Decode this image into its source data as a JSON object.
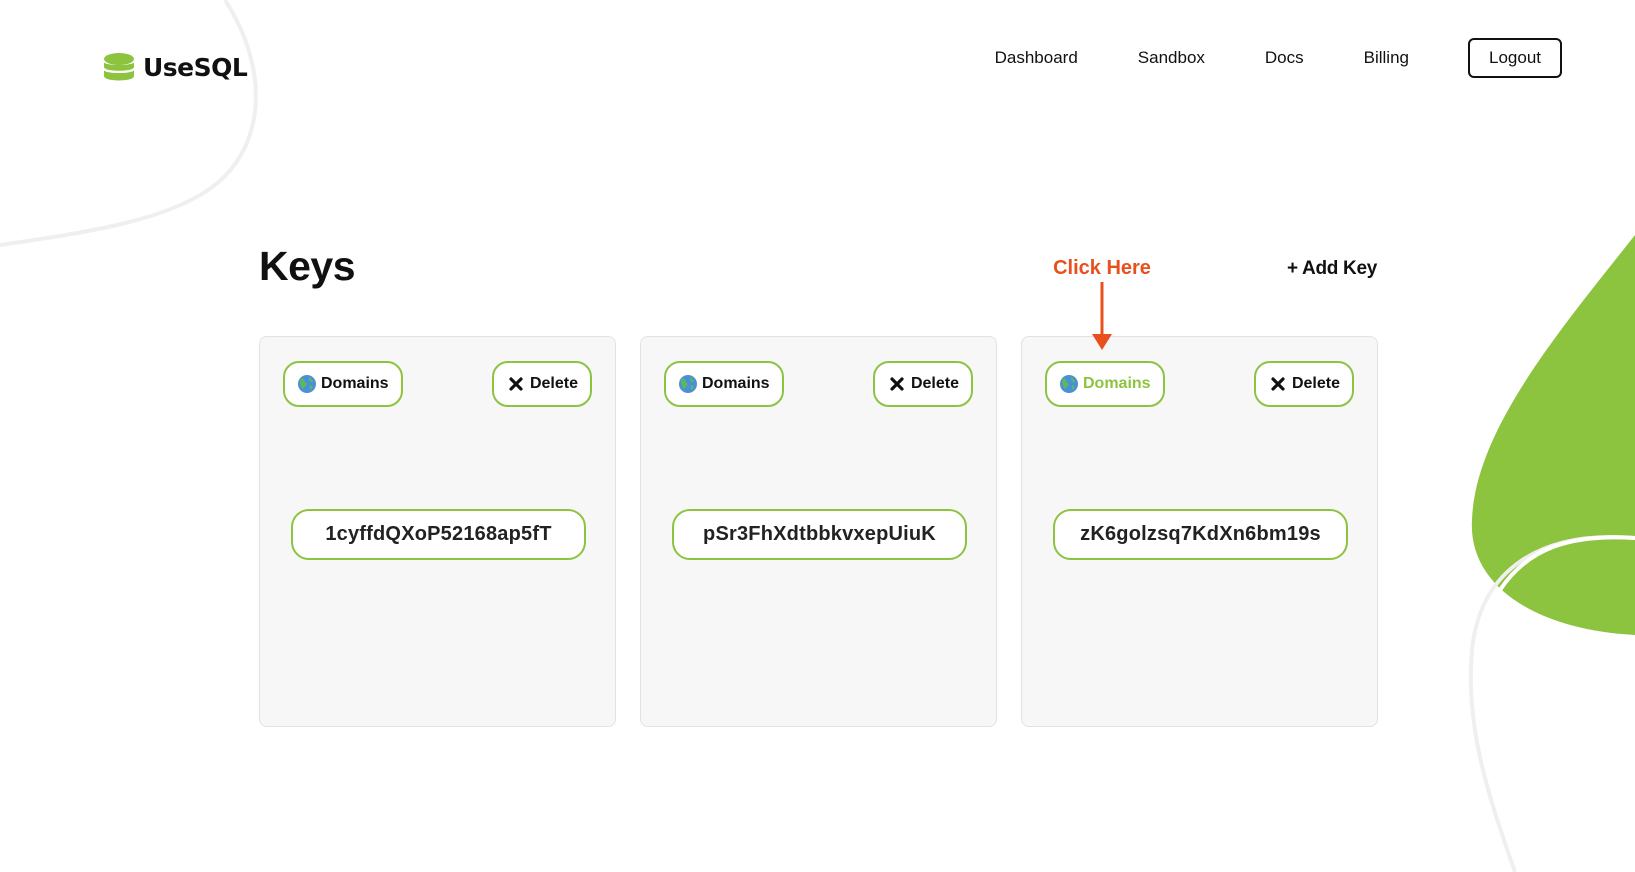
{
  "header": {
    "logo_text": "UseSQL",
    "nav": {
      "dashboard": "Dashboard",
      "sandbox": "Sandbox",
      "docs": "Docs",
      "billing": "Billing"
    },
    "logout_label": "Logout"
  },
  "main": {
    "title": "Keys",
    "add_key_label": "+ Add Key",
    "annotation": {
      "text": "Click Here",
      "color": "#e8501e"
    },
    "keys": [
      {
        "domains_label": "Domains",
        "delete_label": "Delete",
        "key": "1cyffdQXoP52168ap5fT"
      },
      {
        "domains_label": "Domains",
        "delete_label": "Delete",
        "key": "pSr3FhXdtbbkvxepUiuK"
      },
      {
        "domains_label": "Domains",
        "delete_label": "Delete",
        "key": "zK6golzsq7KdXn6bm19s"
      }
    ],
    "icons": {
      "domains": "globe-icon",
      "delete": "close-x-icon"
    }
  },
  "theme": {
    "accent": "#8cc33f",
    "text": "#111111",
    "card_bg": "#f7f7f7"
  }
}
